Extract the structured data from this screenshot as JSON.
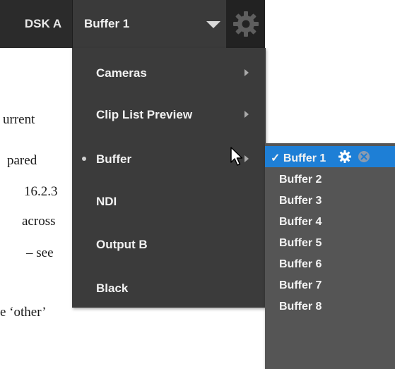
{
  "background_text": [
    "urrent",
    "pared",
    "16.2.3",
    "across",
    "– see",
    "e ‘other’"
  ],
  "toolbar": {
    "dsk_label": "DSK A",
    "dropdown_value": "Buffer 1",
    "gear_icon": "gear-icon"
  },
  "menu": {
    "items": [
      {
        "label": "Cameras",
        "has_submenu": true,
        "current": false
      },
      {
        "label": "Clip List Preview",
        "has_submenu": true,
        "current": false
      },
      {
        "label": "Buffer",
        "has_submenu": true,
        "current": true
      },
      {
        "label": "NDI",
        "has_submenu": false,
        "current": false
      },
      {
        "label": "Output B",
        "has_submenu": false,
        "current": false
      },
      {
        "label": "Black",
        "has_submenu": false,
        "current": false
      }
    ]
  },
  "submenu": {
    "items": [
      {
        "label": "✓ Buffer 1",
        "selected": true
      },
      {
        "label": "Buffer 2",
        "selected": false
      },
      {
        "label": "Buffer 3",
        "selected": false
      },
      {
        "label": "Buffer 4",
        "selected": false
      },
      {
        "label": "Buffer 5",
        "selected": false
      },
      {
        "label": "Buffer 6",
        "selected": false
      },
      {
        "label": "Buffer 7",
        "selected": false
      },
      {
        "label": "Buffer 8",
        "selected": false
      }
    ]
  },
  "colors": {
    "toolbar_bg": "#2b2b2b",
    "menu_bg": "#3b3b3b",
    "submenu_bg": "#555555",
    "selected_bg": "#1e7fd6",
    "text": "#f2f2f2"
  }
}
